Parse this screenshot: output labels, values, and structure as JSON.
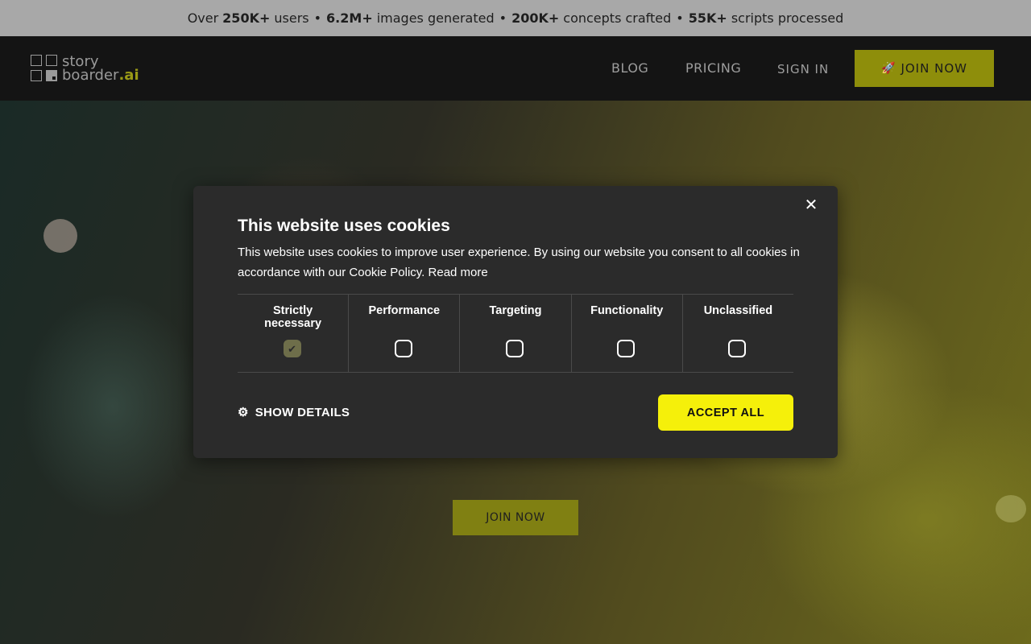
{
  "stats_bar": {
    "prefix": "Over",
    "users_count": "250K+",
    "users_label": "users",
    "images_count": "6.2M+",
    "images_label": "images generated",
    "concepts_count": "200K+",
    "concepts_label": "concepts crafted",
    "scripts_count": "55K+",
    "scripts_label": "scripts processed",
    "separator": "•"
  },
  "nav": {
    "logo_line1": "story",
    "logo_line2": "boarder",
    "logo_suffix": ".ai",
    "blog": "BLOG",
    "pricing": "PRICING",
    "sign_in": "SIGN IN",
    "join_now": "JOIN NOW",
    "join_icon": "rocket-icon"
  },
  "hero": {
    "join_now": "JOIN NOW"
  },
  "cookie_modal": {
    "title": "This website uses cookies",
    "description": "This website uses cookies to improve user experience. By using our website you consent to all cookies in accordance with our Cookie Policy.",
    "read_more": "Read more",
    "close_icon": "close-icon",
    "categories": [
      {
        "label": "Strictly necessary",
        "checked": true
      },
      {
        "label": "Performance",
        "checked": false
      },
      {
        "label": "Targeting",
        "checked": false
      },
      {
        "label": "Functionality",
        "checked": false
      },
      {
        "label": "Unclassified",
        "checked": false
      }
    ],
    "show_details": "SHOW DETAILS",
    "show_details_icon": "gear-icon",
    "accept_all": "ACCEPT ALL"
  },
  "colors": {
    "accent": "#8e8e0b",
    "accept_button": "#f5f00a",
    "modal_bg": "#2b2b2b"
  }
}
